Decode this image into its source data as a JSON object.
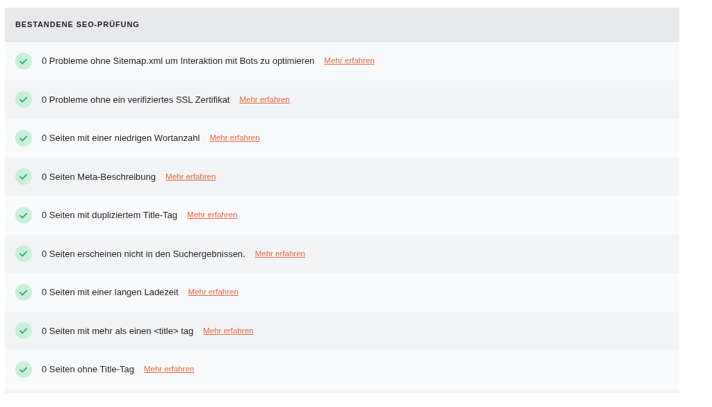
{
  "section": {
    "title": "BESTANDENE SEO-PRÜFUNG"
  },
  "items": [
    {
      "text": "0 Probleme ohne Sitemap.xml um Interaktion mit Bots zu optimieren",
      "link": "Mehr erfahren"
    },
    {
      "text": "0 Probleme ohne ein verifiziertes SSL Zertifikat",
      "link": "Mehr erfahren"
    },
    {
      "text": "0 Seiten mit einer niedrigen Wortanzahl",
      "link": "Mehr erfahren"
    },
    {
      "text": "0 Seiten Meta-Beschreibung",
      "link": "Mehr erfahren"
    },
    {
      "text": "0 Seiten mit dupliziertem Title-Tag",
      "link": "Mehr erfahren"
    },
    {
      "text": "0 Seiten erscheinen nicht in den Suchergebnissen.",
      "link": "Mehr erfahren"
    },
    {
      "text": "0 Seiten mit einer langen Ladezeit",
      "link": "Mehr erfahren"
    },
    {
      "text": "0 Seiten mit mehr als einen <title> tag",
      "link": "Mehr erfahren"
    },
    {
      "text": "0 Seiten ohne Title-Tag",
      "link": "Mehr erfahren"
    }
  ]
}
